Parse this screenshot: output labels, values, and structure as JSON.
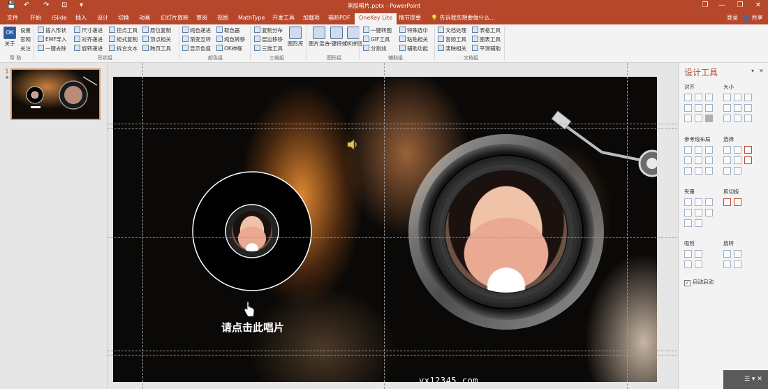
{
  "window": {
    "title": "黑胶唱片.pptx - PowerPoint",
    "minimize": "—",
    "restore": "❐",
    "close": "✕",
    "help": "?"
  },
  "quick_access": [
    "💾",
    "↶",
    "↷",
    "⊡",
    "▾"
  ],
  "tabs": [
    "文件",
    "开始",
    "iSlide",
    "插入",
    "设计",
    "切换",
    "动画",
    "幻灯片放映",
    "审阅",
    "视图",
    "MathType",
    "开发工具",
    "加载项",
    "福昕PDF",
    "OneKey Lite",
    "情节提要"
  ],
  "active_tab": "OneKey Lite",
  "search_hint": "告诉我您想要做什么...",
  "login": "登录",
  "share": "共享",
  "ribbon": {
    "help_group": {
      "logo": "OK",
      "about": "关于",
      "settings": "设置",
      "website": "官网",
      "follow": "关注",
      "label": "帮 助"
    },
    "shape_group": {
      "items": [
        "插入形状",
        "EMF导入",
        "一键去除",
        "尺寸递进",
        "对齐递进",
        "旋转递进",
        "控点工具",
        "矩式复制",
        "拆合文本",
        "原位复制",
        "顶点相关",
        "跨页工具"
      ],
      "label": "形状组"
    },
    "color_group": {
      "items": [
        "纯色递进",
        "渐变互转",
        "显示色值",
        "取色器",
        "纯色转移",
        "OK神框"
      ],
      "label": "颜色组"
    },
    "threed_group": {
      "items": [
        "复制分布",
        "层边移移",
        "三维工具"
      ],
      "big": "图形库",
      "label": "三维组"
    },
    "graphic_group": {
      "big": [
        "图片混合",
        "一键特效",
        "OK拼图"
      ],
      "label": "图形组"
    },
    "assist_group": {
      "items": [
        "一键转图",
        "GIF工具",
        "分割线",
        "特殊选中",
        "粘贴相关",
        "辅助功能"
      ],
      "label": "辅助组"
    },
    "doc_group": {
      "items": [
        "文档处理",
        "音频工具",
        "演映相关",
        "表格工具",
        "图表工具",
        "平滑辅助"
      ],
      "label": "文档组"
    }
  },
  "thumbnail": {
    "number": "1",
    "star": "★"
  },
  "slide": {
    "caption": "请点击此唱片",
    "watermark": "yx12345.com"
  },
  "pane": {
    "title": "设计工具",
    "pin": "▾",
    "close": "✕",
    "sections": [
      "对齐",
      "大小",
      "参考线布局",
      "选择",
      "矢量",
      "剪切板",
      "吸附",
      "旋转"
    ],
    "auto_start": "自动启动",
    "check": "✓",
    "foot": "☰ ▾ ✕"
  },
  "colors": {
    "accent": "#b7472a",
    "ribbon_bg": "#f3f3f3",
    "canvas_bg": "#e6e6e6"
  }
}
